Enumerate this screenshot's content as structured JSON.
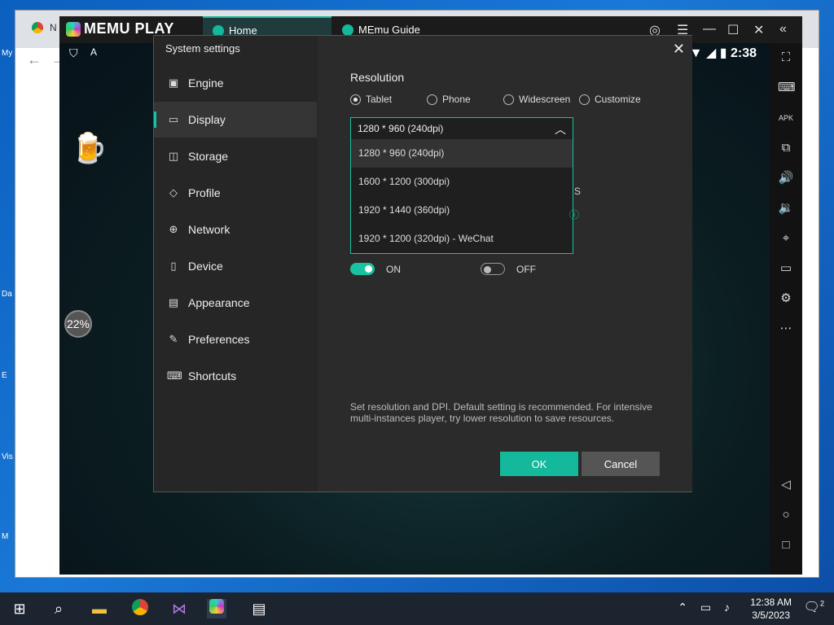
{
  "browser": {
    "tab_partial": "N",
    "side_text": [
      "My",
      "Da",
      "E",
      "Vis",
      "M"
    ]
  },
  "memu": {
    "logo_text": "MEMU PLAY",
    "tabs": [
      {
        "label": "Home"
      },
      {
        "label": "MEmu Guide"
      }
    ],
    "status_time": "2:38",
    "progress_percent": "22%",
    "side_icons": [
      "collapse-icon",
      "fullscreen-icon",
      "keyboard-icon",
      "apk-icon",
      "multi-instance-icon",
      "volume-up-icon",
      "volume-down-icon",
      "location-icon",
      "folder-icon",
      "settings-icon",
      "more-icon",
      "back-icon",
      "home-icon",
      "recents-icon"
    ]
  },
  "dialog": {
    "title": "System settings",
    "nav": [
      {
        "label": "Engine",
        "icon": "engine-icon"
      },
      {
        "label": "Display",
        "icon": "display-icon",
        "active": true
      },
      {
        "label": "Storage",
        "icon": "storage-icon"
      },
      {
        "label": "Profile",
        "icon": "profile-icon"
      },
      {
        "label": "Network",
        "icon": "network-icon"
      },
      {
        "label": "Device",
        "icon": "device-icon"
      },
      {
        "label": "Appearance",
        "icon": "appearance-icon"
      },
      {
        "label": "Preferences",
        "icon": "preferences-icon"
      },
      {
        "label": "Shortcuts",
        "icon": "shortcuts-icon"
      }
    ],
    "resolution_label": "Resolution",
    "radios": [
      {
        "label": "Tablet",
        "checked": true
      },
      {
        "label": "Phone",
        "checked": false
      },
      {
        "label": "Widescreen",
        "checked": false
      },
      {
        "label": "Customize",
        "checked": false
      }
    ],
    "select_value": "1280 * 960 (240dpi)",
    "options": [
      "1280 * 960 (240dpi)",
      "1600 * 1200 (300dpi)",
      "1920 * 1440 (360dpi)",
      "1920 * 1200 (320dpi) - WeChat"
    ],
    "peek_text": "S",
    "toggle_on_label": "ON",
    "toggle_off_label": "OFF",
    "description": "Set resolution and DPI. Default setting is recommended. For intensive multi-instances player, try lower resolution to save resources.",
    "ok_label": "OK",
    "cancel_label": "Cancel"
  },
  "taskbar": {
    "time": "12:38 AM",
    "date": "3/5/2023",
    "notification_count": "2"
  },
  "colors": {
    "accent": "#17c3a1",
    "dialog_bg": "#2b2b2b",
    "taskbar": "#1c2430"
  }
}
